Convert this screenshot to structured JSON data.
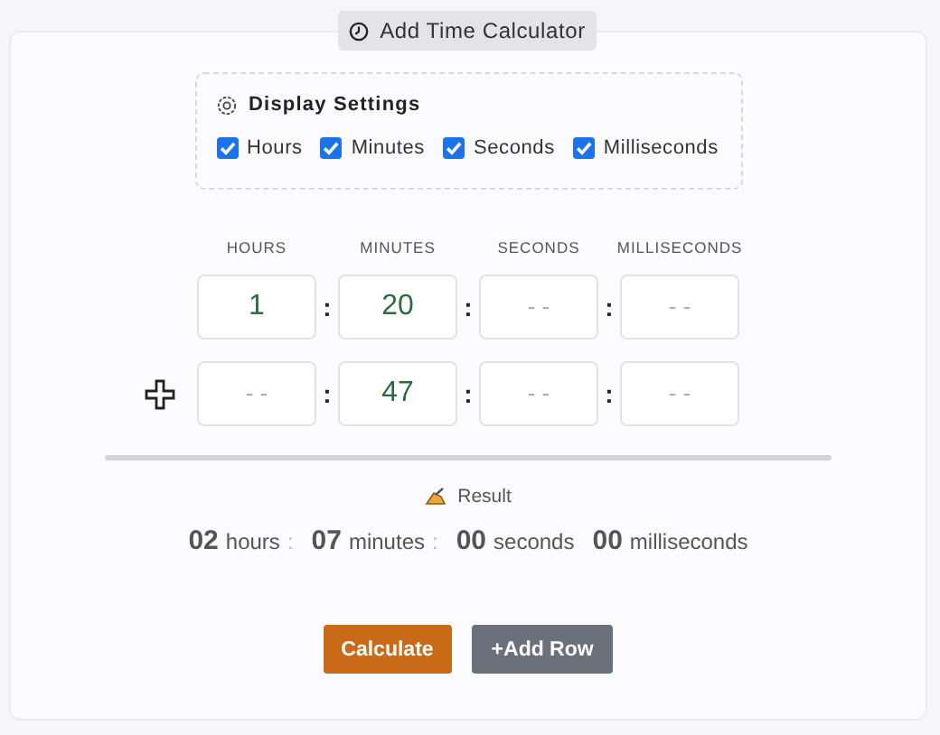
{
  "header_button": {
    "label": "Add Time Calculator"
  },
  "display_settings": {
    "title": "Display Settings",
    "options": [
      {
        "label": "Hours",
        "checked": true
      },
      {
        "label": "Minutes",
        "checked": true
      },
      {
        "label": "Seconds",
        "checked": true
      },
      {
        "label": "Milliseconds",
        "checked": true
      }
    ]
  },
  "columns": [
    "HOURS",
    "MINUTES",
    "SECONDS",
    "MILLISECONDS"
  ],
  "rows": [
    {
      "kind": "base",
      "fields": [
        {
          "value": "1"
        },
        {
          "value": "20"
        },
        {
          "placeholder": "- -"
        },
        {
          "placeholder": "- -"
        }
      ],
      "separators": [
        ":",
        ":",
        ":"
      ]
    },
    {
      "kind": "plus",
      "fields": [
        {
          "placeholder": "- -"
        },
        {
          "value": "47"
        },
        {
          "placeholder": "- -"
        },
        {
          "placeholder": "- -"
        }
      ],
      "separators": [
        ":",
        ":",
        ":"
      ]
    }
  ],
  "result": {
    "title": "Result",
    "parts": [
      {
        "number": "02",
        "unit": "hours",
        "separator": ":"
      },
      {
        "number": "07",
        "unit": "minutes",
        "separator": ":"
      },
      {
        "number": "00",
        "unit": "seconds"
      },
      {
        "number": "00",
        "unit": "milliseconds"
      }
    ]
  },
  "buttons": [
    {
      "label": "Calculate",
      "kind": "primary"
    },
    {
      "label": "+Add Row",
      "kind": "secondary"
    }
  ]
}
